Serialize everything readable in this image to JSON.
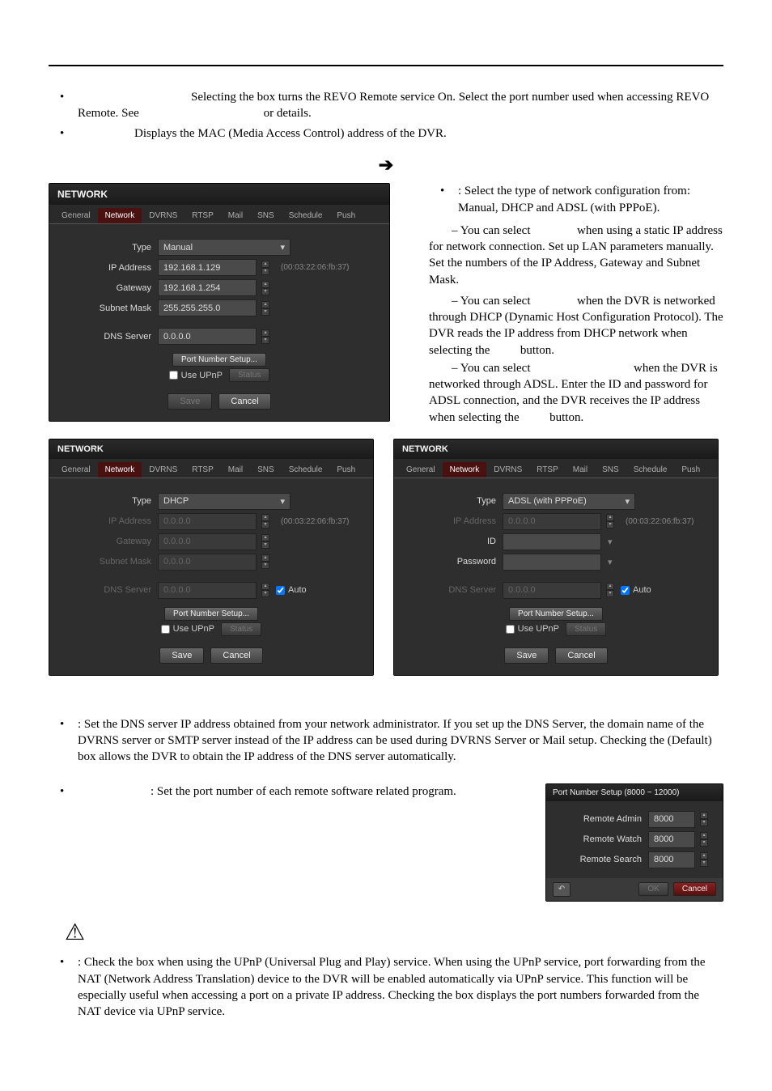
{
  "bullets1": {
    "a": "Selecting the box turns the REVO Remote service On.  Select the port number used when accessing REVO Remote.  See",
    "a2": "or details.",
    "b": "Displays the MAC (Media Access Control) address of the DVR."
  },
  "arrow": "➔",
  "dlg": {
    "title": "NETWORK",
    "tabs": [
      "General",
      "Network",
      "DVRNS",
      "RTSP",
      "Mail",
      "SNS",
      "Schedule",
      "Push"
    ],
    "labels": {
      "type": "Type",
      "ip": "IP Address",
      "gw": "Gateway",
      "mask": "Subnet Mask",
      "dns": "DNS Server",
      "id": "ID",
      "pw": "Password"
    },
    "manual": {
      "type": "Manual",
      "ip": "192.168.1.129",
      "gw": "192.168.1.254",
      "mask": "255.255.255.0",
      "dns": "0.0.0.0",
      "mac": "(00:03:22:06:fb:37)"
    },
    "dhcp": {
      "type": "DHCP",
      "ip": "0.0.0.0",
      "gw": "0.0.0.0",
      "mask": "0.0.0.0",
      "dns": "0.0.0.0",
      "mac": "(00:03:22:06:fb:37)",
      "auto": "Auto"
    },
    "adsl": {
      "type": "ADSL (with PPPoE)",
      "ip": "0.0.0.0",
      "dns": "0.0.0.0",
      "mac": "(00:03:22:06:fb:37)",
      "auto": "Auto"
    },
    "btn": {
      "port": "Port Number Setup...",
      "upnp": "Use UPnP",
      "status": "Status",
      "save": "Save",
      "cancel": "Cancel"
    }
  },
  "side": {
    "head": ": Select the type of network configuration from: Manual, DHCP and ADSL (with PPPoE).",
    "p1a": "– You can select",
    "p1b": "when using a static IP address for network connection.  Set up LAN parameters manually. Set the numbers of the IP Address, Gateway and Subnet Mask.",
    "p2a": "– You can select",
    "p2b": "when the DVR is networked through DHCP (Dynamic Host Configuration Protocol).  The DVR reads the IP address from DHCP network when selecting the",
    "p2c": "button.",
    "p3a": "– You can select",
    "p3b": "when the DVR is networked through ADSL.  Enter the ID and password for ADSL connection, and the DVR receives the IP address when selecting the",
    "p3c": "button."
  },
  "bullets2": {
    "dns": ":  Set the DNS server IP address obtained from your network administrator.  If you set up the DNS Server, the domain name of the DVRNS server or SMTP server instead of the IP address can be used during DVRNS Server or Mail setup.  Checking the        (Default) box allows the DVR to obtain the IP address of the DNS server automatically.",
    "port": ":  Set the port number of each remote software related program."
  },
  "portdlg": {
    "title": "Port Number Setup (8000 ~ 12000)",
    "rows": [
      {
        "label": "Remote Admin",
        "val": "8000"
      },
      {
        "label": "Remote Watch",
        "val": "8000"
      },
      {
        "label": "Remote Search",
        "val": "8000"
      }
    ],
    "ok": "OK",
    "cancel": "Cancel"
  },
  "bullets3": {
    "upnp": ":  Check the box when using the UPnP (Universal Plug and Play) service.  When using the UPnP service, port forwarding from the NAT (Network Address Translation) device to the DVR will be enabled automatically via UPnP service.  This function will be especially useful when accessing a port on a private IP address.  Checking the        box displays the port numbers forwarded from the NAT device via UPnP service."
  }
}
